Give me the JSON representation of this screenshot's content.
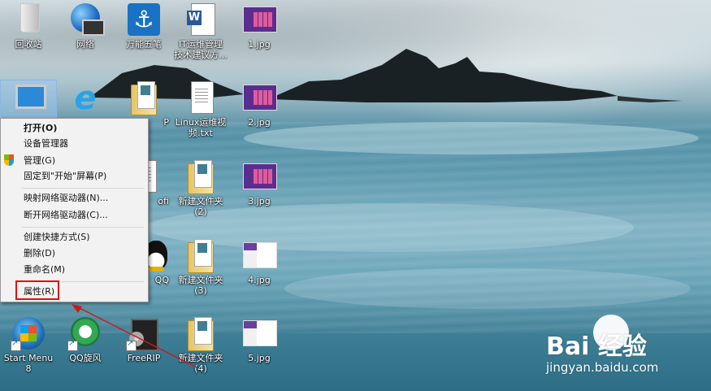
{
  "desktop": {
    "icons": {
      "recycle": "回收站",
      "network": "网络",
      "wanneng": "万能五笔",
      "itdoc_line1": "IT运维管理",
      "itdoc_line2": "技术建议方...",
      "jpg1": "1.jpg",
      "lp": "P",
      "linux_line1": "Linux运维视",
      "linux_line2": "频.txt",
      "jpg2": "2.jpg",
      "folder2_line1": "新建文件夹",
      "folder2_line2": "(2)",
      "jpg3": "3.jpg",
      "partial_label": "ofi",
      "qq": "QQ",
      "folder3_line1": "新建文件夹",
      "folder3_line2": "(3)",
      "jpg4": "4.jpg",
      "startmenu_line1": "Start Menu",
      "startmenu_line2": "8",
      "qqxuanfeng": "QQ旋风",
      "freerip": "FreeRIP",
      "folder4_line1": "新建文件夹",
      "folder4_line2": "(4)",
      "jpg5": "5.jpg"
    }
  },
  "context_menu": {
    "items": [
      {
        "label": "打开(O)"
      },
      {
        "label": "设备管理器"
      },
      {
        "label": "管理(G)"
      },
      {
        "label": "固定到\"开始\"屏幕(P)"
      },
      {
        "label": "映射网络驱动器(N)..."
      },
      {
        "label": "断开网络驱动器(C)..."
      },
      {
        "label": "创建快捷方式(S)"
      },
      {
        "label": "删除(D)"
      },
      {
        "label": "重命名(M)"
      },
      {
        "label": "属性(R)"
      }
    ]
  },
  "watermark": {
    "logo_text": "Bai  经验",
    "url": "jingyan.baidu.com"
  },
  "colors": {
    "highlight_box": "#e01010",
    "menu_bg": "#f2f2f2"
  }
}
